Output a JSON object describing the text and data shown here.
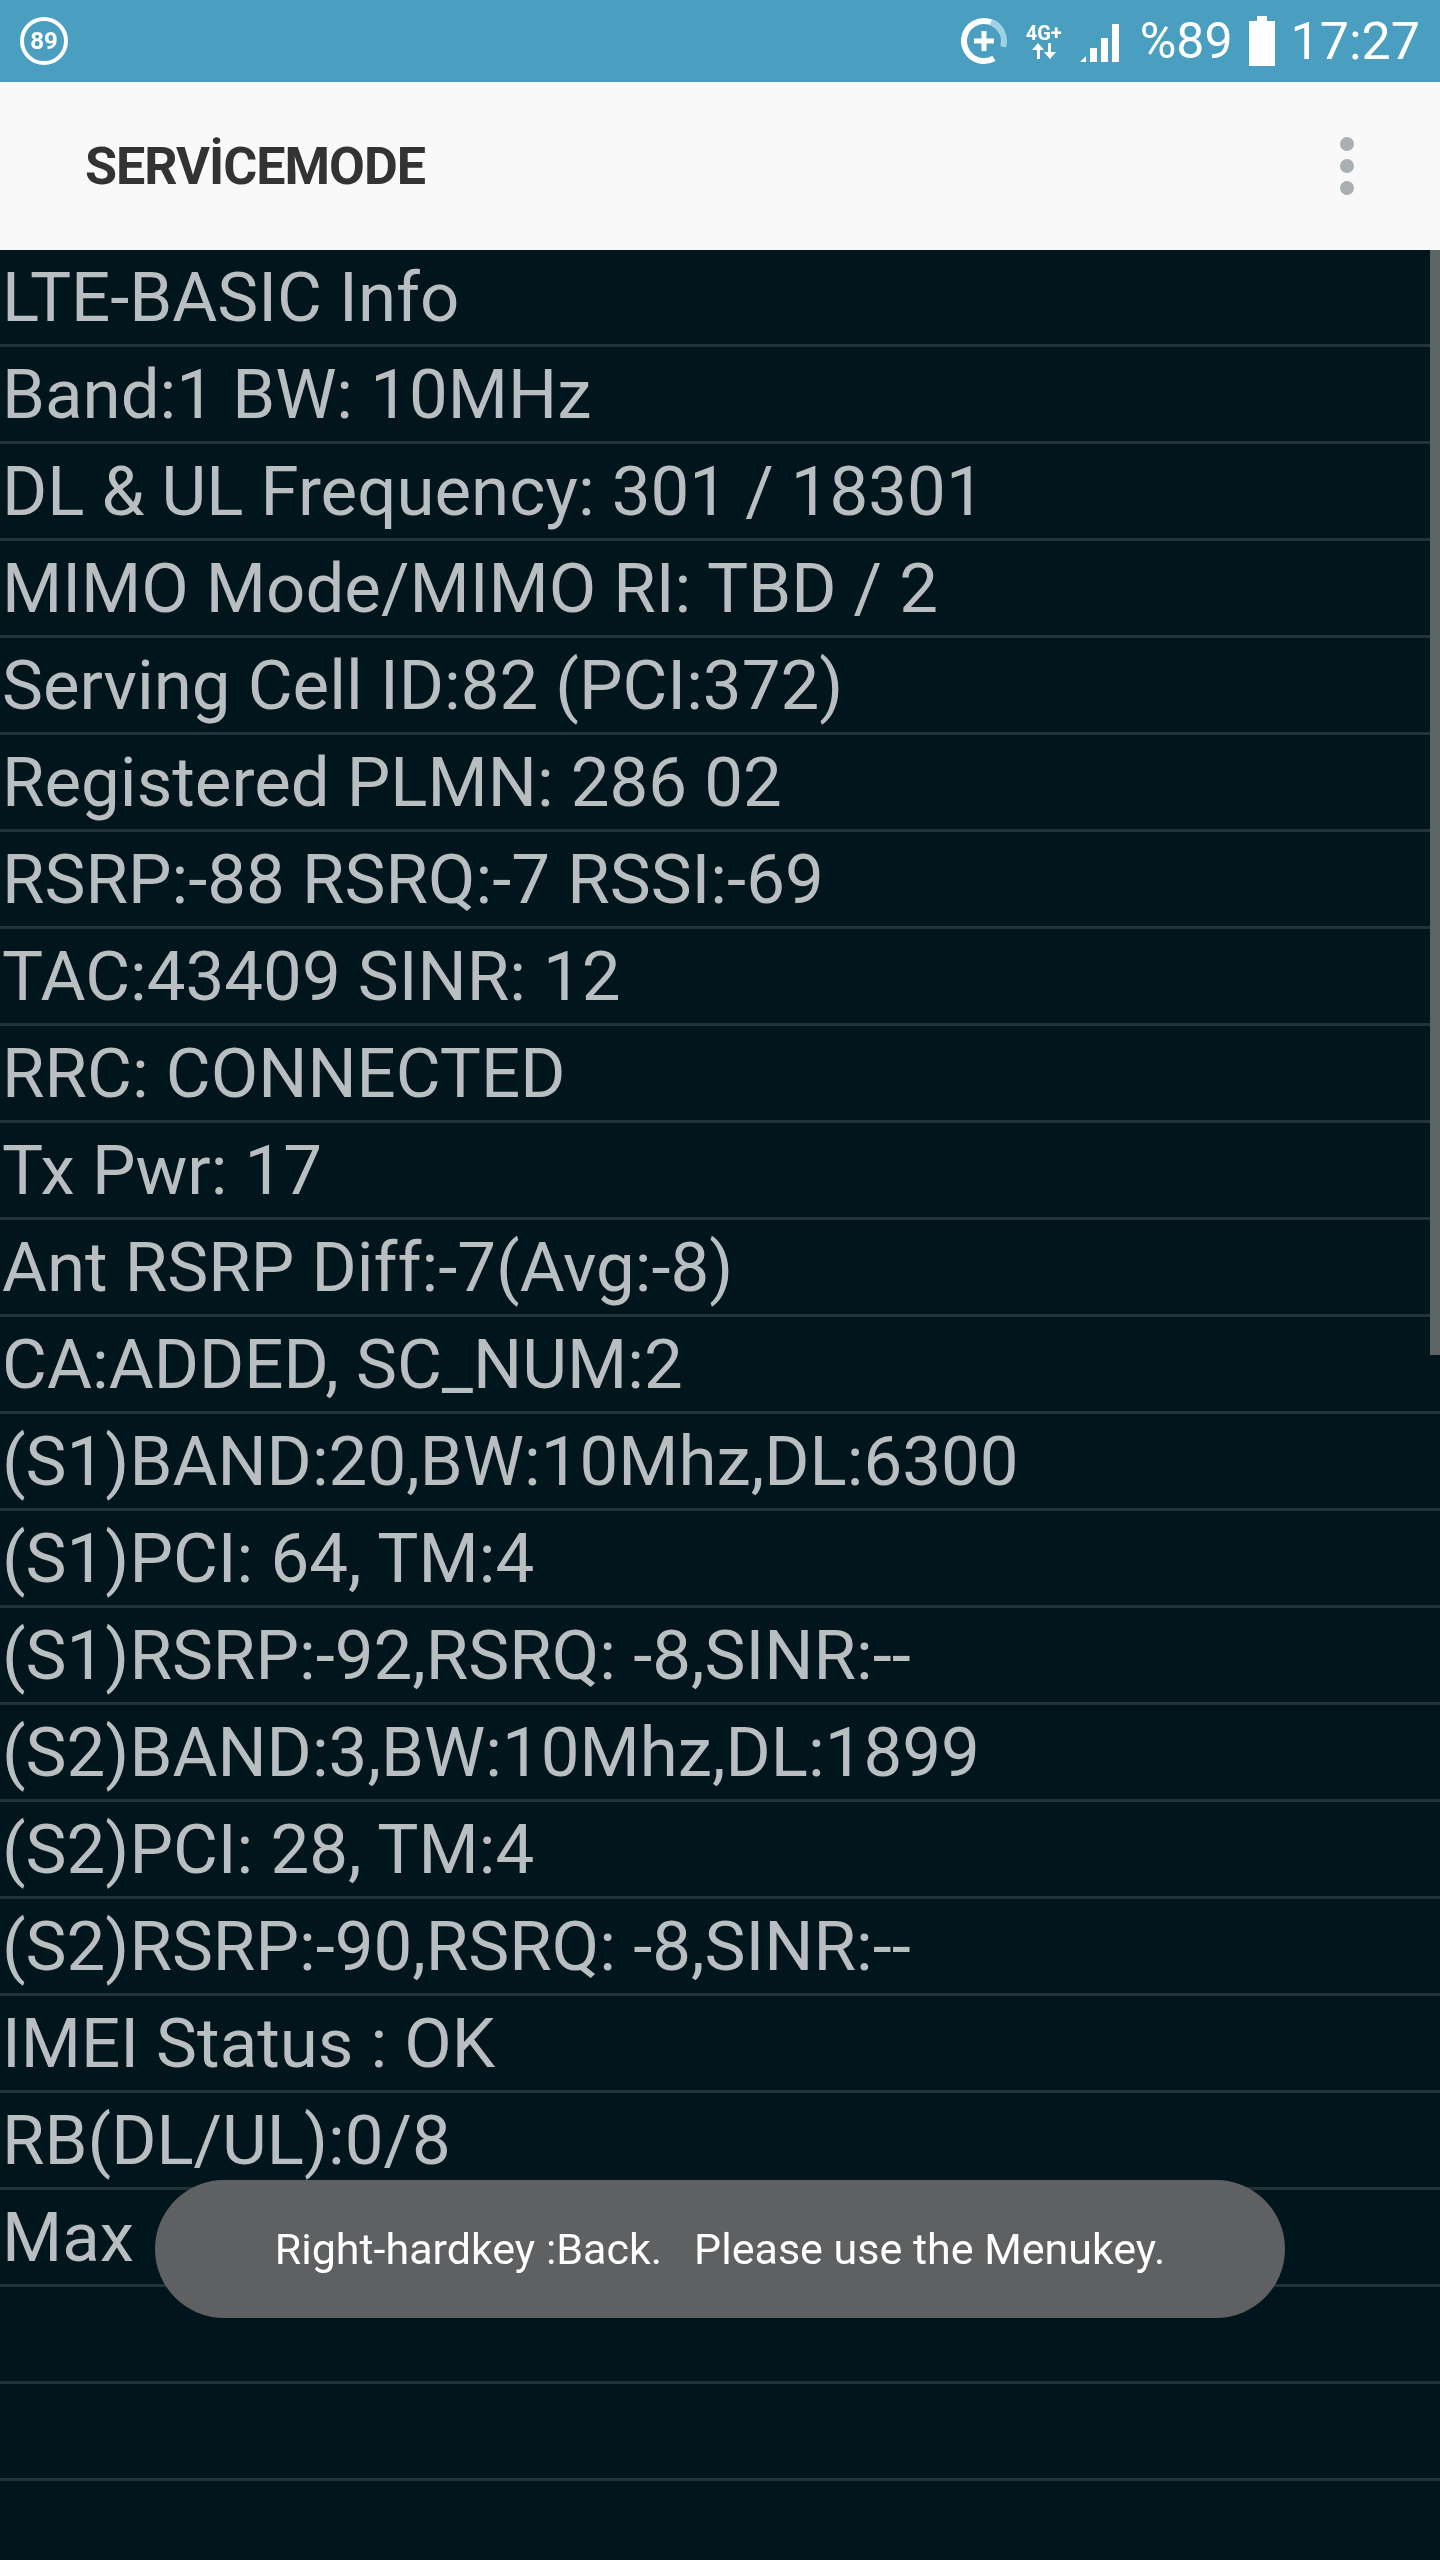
{
  "status_bar": {
    "notification_badge": "89",
    "network": "4G+",
    "battery": "%89",
    "time": "17:27"
  },
  "app_bar": {
    "title": "SERVİCEMODE"
  },
  "rows": [
    "LTE-BASIC Info",
    "Band:1 BW: 10MHz",
    "DL & UL Frequency: 301 / 18301",
    "MIMO Mode/MIMO RI: TBD / 2",
    "Serving Cell ID:82 (PCI:372)",
    "Registered PLMN: 286 02",
    "RSRP:-88 RSRQ:-7 RSSI:-69",
    "TAC:43409 SINR: 12",
    "RRC: CONNECTED",
    "Tx Pwr: 17",
    "Ant RSRP Diff:-7(Avg:-8)",
    "CA:ADDED, SC_NUM:2",
    "(S1)BAND:20,BW:10Mhz,DL:6300",
    "(S1)PCI: 64, TM:4",
    "(S1)RSRP:-92,RSRQ: -8,SINR:--",
    "(S2)BAND:3,BW:10Mhz,DL:1899",
    "(S2)PCI: 28, TM:4",
    "(S2)RSRP:-90,RSRQ: -8,SINR:--",
    "IMEI Status : OK",
    "RB(DL/UL):0/8",
    "Max"
  ],
  "toast": "Right-hardkey :Back.   Please use the Menukey."
}
